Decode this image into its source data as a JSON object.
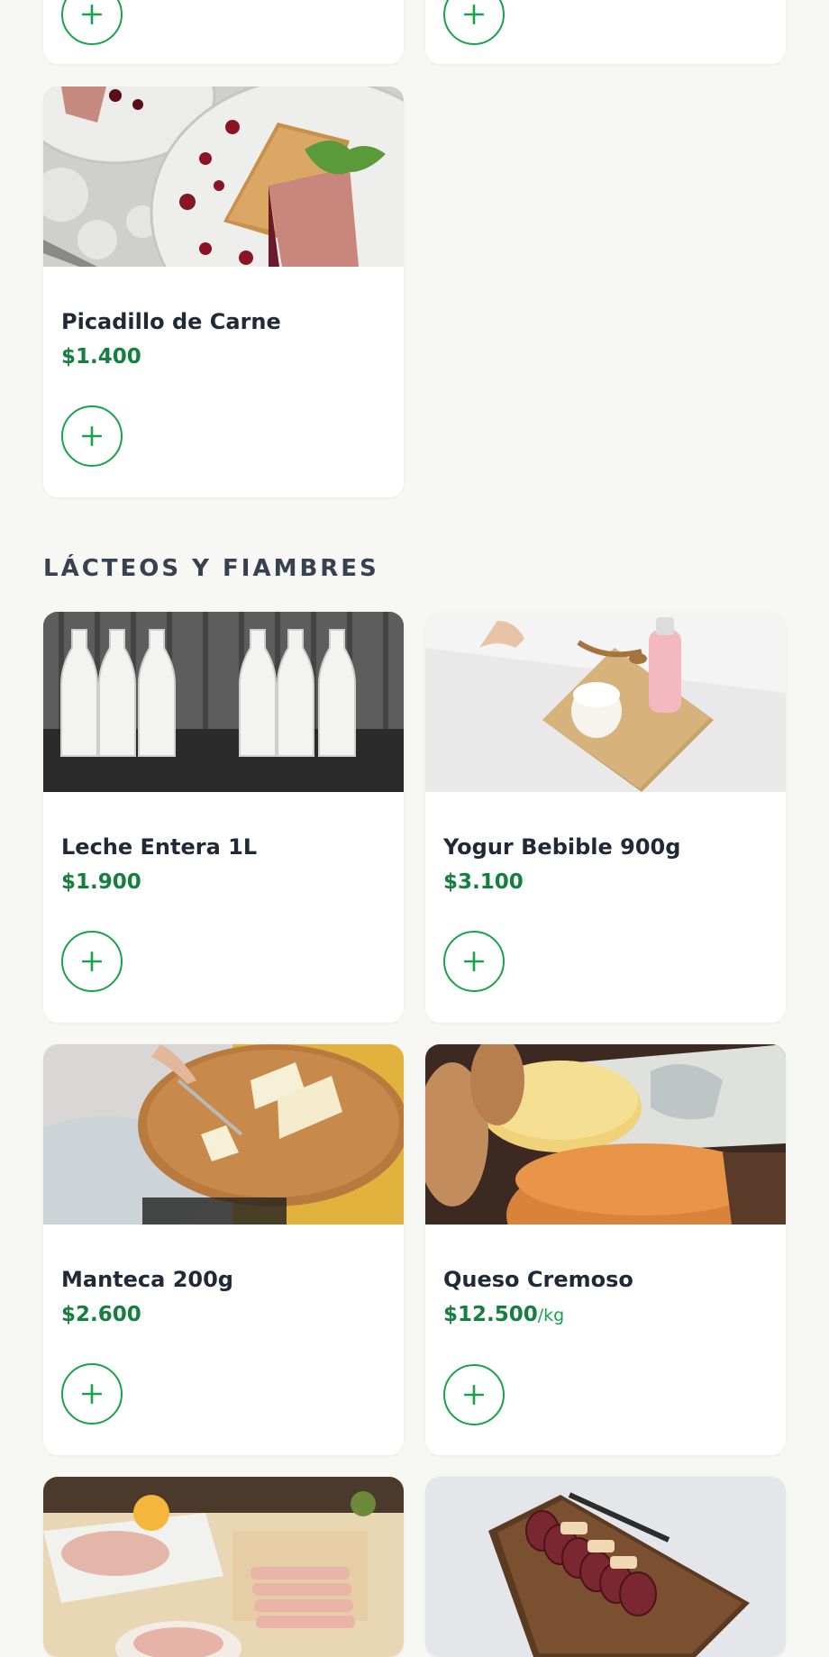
{
  "colors": {
    "accent": "#16a34a",
    "price": "#15803d",
    "background": "#f7f7f4",
    "card": "#ffffff"
  },
  "top_partial_cards": [
    {
      "add_icon": "plus-icon"
    },
    {
      "add_icon": "plus-icon"
    }
  ],
  "previous_section": {
    "products": [
      {
        "name": "Picadillo de Carne",
        "price": "$1.400",
        "image": "pate-plate-photo",
        "add_icon": "plus-icon"
      }
    ]
  },
  "dairy_section": {
    "title": "LÁCTEOS Y FIAMBRES",
    "products": [
      {
        "name": "Leche Entera 1L",
        "price": "$1.900",
        "image": "milk-bottles-photo"
      },
      {
        "name": "Yogur Bebible 900g",
        "price": "$3.100",
        "image": "yogurt-board-photo"
      },
      {
        "name": "Manteca 200g",
        "price": "$2.600",
        "image": "butter-plate-photo"
      },
      {
        "name": "Queso Cremoso",
        "price": "$12.500",
        "unit": "/kg",
        "image": "cheese-board-photo"
      },
      {
        "image": "cold-cuts-platter-photo"
      },
      {
        "image": "salami-board-photo"
      }
    ]
  }
}
